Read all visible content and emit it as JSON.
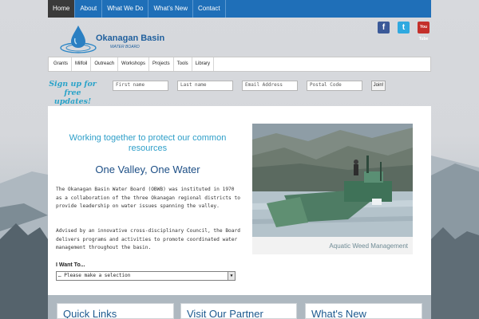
{
  "nav": {
    "items": [
      {
        "label": "Home",
        "active": true
      },
      {
        "label": "About",
        "active": false
      },
      {
        "label": "What We Do",
        "active": false
      },
      {
        "label": "What’s New",
        "active": false
      },
      {
        "label": "Contact",
        "active": false
      }
    ]
  },
  "logo": {
    "title": "Okanagan Basin",
    "subtitle": "WATER BOARD"
  },
  "social": {
    "facebook_icon": "f",
    "twitter_icon": "t",
    "youtube_icon": "You Tube"
  },
  "submenu": {
    "items": [
      "Grants",
      "Milfoil",
      "Outreach",
      "Workshops",
      "Projects",
      "Tools",
      "Library"
    ]
  },
  "signup": {
    "heading_line1": "Sign up for",
    "heading_line2": "free updates!",
    "first_name_placeholder": "First name",
    "last_name_placeholder": "Last name",
    "email_placeholder": "Email Address",
    "postal_placeholder": "Postal Code",
    "join_label": "Join!"
  },
  "main": {
    "tagline": "Working together to protect our common resources",
    "headline": "One Valley, One Water",
    "paragraph1": "The Okanagan Basin Water Board (OBWB) was instituted in 1970 as a collaboration of the three Okanagan regional districts to provide leadership on water issues spanning the valley.",
    "paragraph2": "Advised by an innovative cross-disciplinary Council, the Board delivers programs and activities to promote coordinated water management throughout the basin.",
    "i_want_label": "I Want To...",
    "select_value": "… Please make a selection",
    "photo_caption": "Aquatic Weed Management"
  },
  "cards": {
    "quick_links": "Quick Links",
    "visit_partner": "Visit Our Partner",
    "whats_new": "What's New"
  },
  "colors": {
    "nav_blue": "#1f6fb8",
    "nav_active": "#3a3a3a",
    "accent_teal": "#2f9fc9",
    "headline_blue": "#1d4f86"
  }
}
